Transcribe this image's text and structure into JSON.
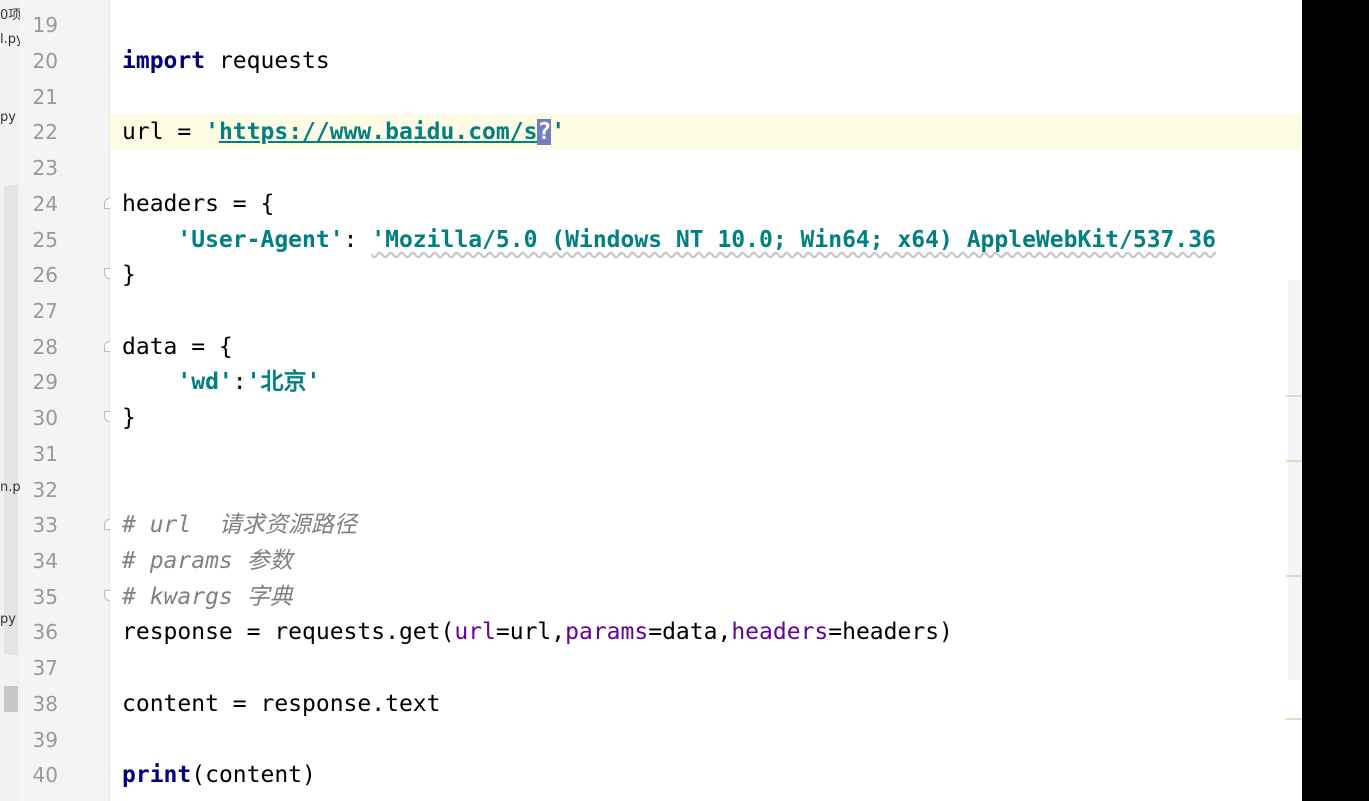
{
  "left_fragments": [
    "0项",
    "l.py",
    "py",
    "n.p",
    "py",
    ".py"
  ],
  "line_numbers": [
    "19",
    "20",
    "21",
    "22",
    "23",
    "24",
    "25",
    "26",
    "27",
    "28",
    "29",
    "30",
    "31",
    "32",
    "33",
    "34",
    "35",
    "36",
    "37",
    "38",
    "39",
    "40"
  ],
  "code": {
    "l20_kw": "import",
    "l20_rest": " requests",
    "l22_a": "url = ",
    "l22_q1": "'",
    "l22_url": "https://www.baidu.com/s",
    "l22_sel": "?",
    "l22_q2": "'",
    "l24": "headers = {",
    "l25_indent": "    ",
    "l25_key": "'User-Agent'",
    "l25_colon": ": ",
    "l25_val": "'Mozilla/5.0 (Windows NT 10.0; Win64; x64) AppleWebKit/537.36",
    "l26": "}",
    "l28": "data = {",
    "l29_indent": "    ",
    "l29_key": "'wd'",
    "l29_colon": ":",
    "l29_val": "'北京'",
    "l30": "}",
    "l33": "# url  请求资源路径",
    "l34": "# params 参数",
    "l35": "# kwargs 字典",
    "l36_a": "response = requests.get(",
    "l36_p1": "url",
    "l36_b": "=url,",
    "l36_p2": "params",
    "l36_c": "=data,",
    "l36_p3": "headers",
    "l36_d": "=headers)",
    "l38": "content = response.text",
    "l40_kw": "print",
    "l40_rest": "(content)"
  },
  "colors": {
    "keyword": "#000080",
    "string": "#008080",
    "comment": "#808080",
    "param": "#660099",
    "current_line": "#fefbe5"
  }
}
